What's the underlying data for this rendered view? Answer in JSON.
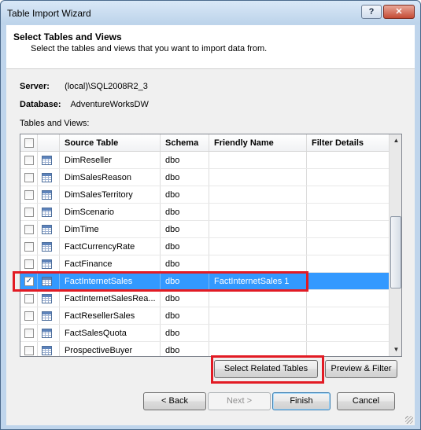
{
  "window": {
    "title": "Table Import Wizard",
    "help_label": "?",
    "close_label": "✕"
  },
  "header": {
    "title": "Select Tables and Views",
    "subtitle": "Select the tables and views that you want to import data from."
  },
  "server": {
    "label": "Server:",
    "value": "(local)\\SQL2008R2_3"
  },
  "database": {
    "label": "Database:",
    "value": "AdventureWorksDW"
  },
  "tables_label": "Tables and Views:",
  "grid": {
    "columns": [
      "Source Table",
      "Schema",
      "Friendly Name",
      "Filter Details"
    ],
    "rows": [
      {
        "checked": false,
        "source": "DimReseller",
        "schema": "dbo",
        "friendly": "",
        "filter": ""
      },
      {
        "checked": false,
        "source": "DimSalesReason",
        "schema": "dbo",
        "friendly": "",
        "filter": ""
      },
      {
        "checked": false,
        "source": "DimSalesTerritory",
        "schema": "dbo",
        "friendly": "",
        "filter": ""
      },
      {
        "checked": false,
        "source": "DimScenario",
        "schema": "dbo",
        "friendly": "",
        "filter": ""
      },
      {
        "checked": false,
        "source": "DimTime",
        "schema": "dbo",
        "friendly": "",
        "filter": ""
      },
      {
        "checked": false,
        "source": "FactCurrencyRate",
        "schema": "dbo",
        "friendly": "",
        "filter": ""
      },
      {
        "checked": false,
        "source": "FactFinance",
        "schema": "dbo",
        "friendly": "",
        "filter": ""
      },
      {
        "checked": true,
        "source": "FactInternetSales",
        "schema": "dbo",
        "friendly": "FactInternetSales 1",
        "filter": "",
        "selected": true
      },
      {
        "checked": false,
        "source": "FactInternetSalesRea...",
        "schema": "dbo",
        "friendly": "",
        "filter": ""
      },
      {
        "checked": false,
        "source": "FactResellerSales",
        "schema": "dbo",
        "friendly": "",
        "filter": ""
      },
      {
        "checked": false,
        "source": "FactSalesQuota",
        "schema": "dbo",
        "friendly": "",
        "filter": ""
      },
      {
        "checked": false,
        "source": "ProspectiveBuyer",
        "schema": "dbo",
        "friendly": "",
        "filter": ""
      }
    ],
    "check_glyph": "✓"
  },
  "scrollbar": {
    "up_glyph": "▲",
    "down_glyph": "▼"
  },
  "actions": {
    "select_related": "Select Related Tables",
    "preview_filter": "Preview & Filter"
  },
  "nav": {
    "back": "< Back",
    "next": "Next >",
    "finish": "Finish",
    "cancel": "Cancel"
  },
  "colors": {
    "selection": "#3399ff",
    "highlight_box": "#e21b24"
  }
}
